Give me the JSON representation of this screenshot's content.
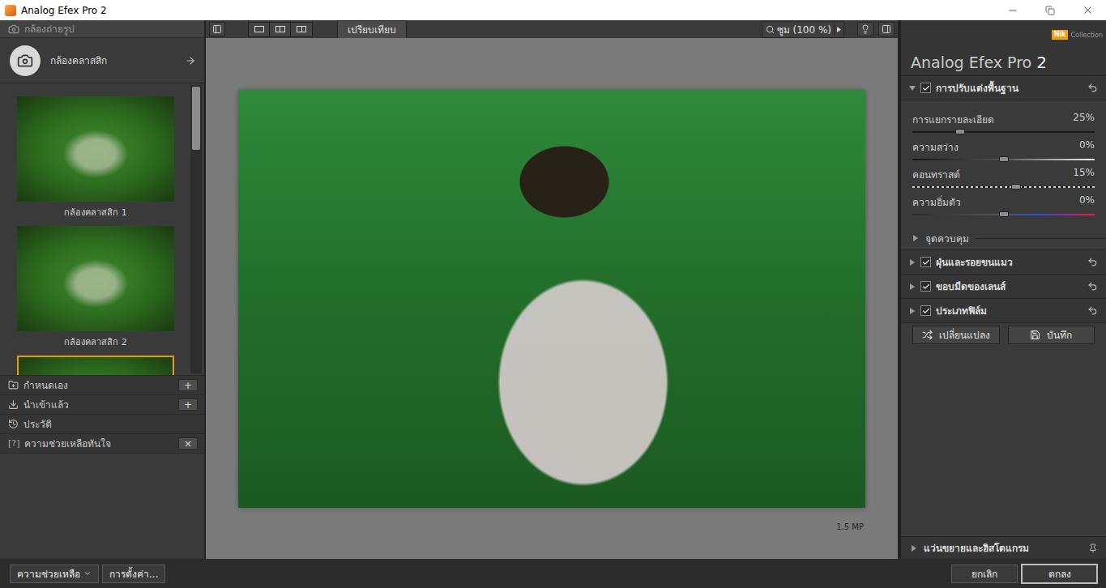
{
  "window": {
    "title": "Analog Efex Pro 2"
  },
  "left_panel": {
    "header": "กล้องถ่ายรูป",
    "category": "กล้องคลาสสิก",
    "presets": [
      {
        "label": "กล้องคลาสสิก 1",
        "selected": false
      },
      {
        "label": "กล้องคลาสสิก 2",
        "selected": false
      },
      {
        "selected": true
      }
    ],
    "scrollbar": {
      "level": 0.22
    },
    "sections": [
      {
        "label": "กำหนดเอง",
        "kind": "custom",
        "action": "+"
      },
      {
        "label": "นำเข้าแล้ว",
        "kind": "imported",
        "action": "+"
      },
      {
        "label": "ประวัติ",
        "kind": "history"
      },
      {
        "label": "ความช่วยเหลือทันใจ",
        "kind": "help",
        "prefix": "[?]",
        "action": "×"
      }
    ]
  },
  "toolbar": {
    "compare": "เปรียบเทียบ",
    "zoom": "ซูม (100 %)"
  },
  "preview": {
    "megapixels": "1.5 MP"
  },
  "right_panel": {
    "logo": {
      "brand": "Nik",
      "sub": "Collection"
    },
    "title": "Analog Efex Pro",
    "version": "2",
    "basic": {
      "label": "การปรับแต่งพื้นฐาน",
      "checked": true,
      "expanded": true
    },
    "sliders": [
      {
        "label": "การแยกรายละเอียด",
        "reading": "25%",
        "level": 0.26,
        "kind": "plain"
      },
      {
        "label": "ความสว่าง",
        "reading": "0%",
        "level": 0.5,
        "kind": "brightness"
      },
      {
        "label": "คอนทราสต์",
        "reading": "15%",
        "level": 0.57,
        "kind": "contrast"
      },
      {
        "label": "ความอิ่มตัว",
        "reading": "0%",
        "level": 0.5,
        "kind": "saturation"
      }
    ],
    "control_points": {
      "label": "จุดควบคุม",
      "expanded": false
    },
    "sections": [
      {
        "label": "ฝุ่นและรอยขนแมว",
        "checked": true,
        "expanded": false
      },
      {
        "label": "ขอบมืดของเลนส์",
        "checked": true,
        "expanded": false
      },
      {
        "label": "ประเภทฟิล์ม",
        "checked": true,
        "expanded": false
      }
    ],
    "buttons": [
      {
        "label": "เปลี่ยนแปลง",
        "kind": "shuffle"
      },
      {
        "label": "บันทึก",
        "kind": "save"
      }
    ],
    "loupe": {
      "label": "แว่นขยายและฮิสโตแกรม",
      "expanded": false
    }
  },
  "bottom_bar": {
    "left": [
      {
        "label": "ความช่วยเหลือ",
        "dropdown": true
      },
      {
        "label": "การตั้งค่า...",
        "dropdown": false
      }
    ],
    "right": [
      {
        "label": "ยกเลิก",
        "primary": false
      },
      {
        "label": "ตกลง",
        "primary": true
      }
    ]
  }
}
